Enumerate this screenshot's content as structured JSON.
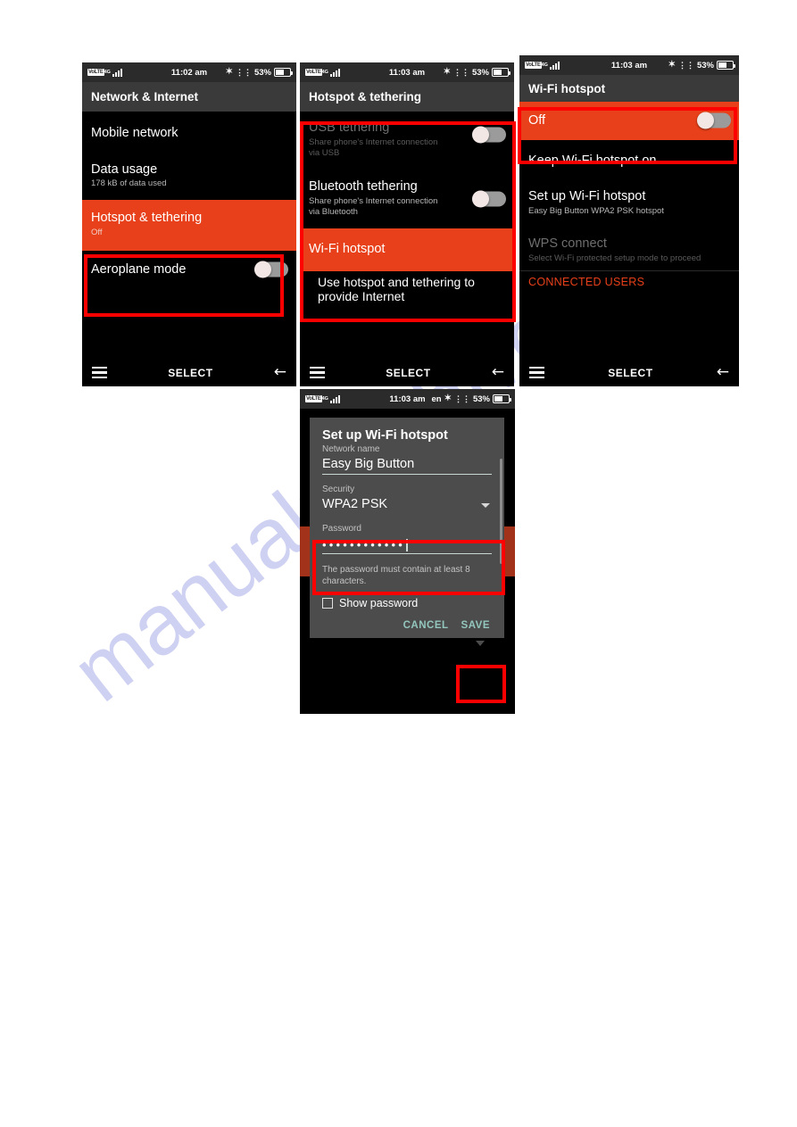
{
  "watermark": {
    "text": "manualsarchive.com"
  },
  "status_bar": {
    "network_badge": "VoLTE",
    "network_gen": "4G",
    "time_1": "11:02 am",
    "time_2": "11:03 am",
    "language": "en",
    "battery_percent": "53%",
    "bluetooth_icon": "bluetooth-icon",
    "vibrate_icon": "vibrate-icon",
    "battery_icon": "battery-icon",
    "signal_icon": "signal-bars-icon"
  },
  "nav_bar": {
    "menu_icon": "hamburger-menu-icon",
    "select_label": "SELECT",
    "back_icon": "back-arrow-icon"
  },
  "colors": {
    "highlight_orange": "#e8401a",
    "annotation_red": "#ff0000",
    "appbar_gray": "#3a3a3a",
    "dialog_gray": "#4c4c4c",
    "accent_teal": "#93c6bd"
  },
  "screen1": {
    "title": "Network & Internet",
    "time": "11:02 am",
    "rows": [
      {
        "title": "Mobile network",
        "sub": "",
        "state": "normal"
      },
      {
        "title": "Data usage",
        "sub": "178 kB of data used",
        "state": "normal"
      },
      {
        "title": "Hotspot & tethering",
        "sub": "Off",
        "state": "highlighted"
      },
      {
        "title": "Aeroplane mode",
        "sub": "",
        "state": "toggle-off"
      }
    ]
  },
  "screen2": {
    "title": "Hotspot & tethering",
    "time": "11:03 am",
    "rows": [
      {
        "title": "USB tethering",
        "sub": "Share phone's Internet connection via USB",
        "state": "disabled",
        "toggle": "off"
      },
      {
        "title": "Bluetooth tethering",
        "sub": "Share phone's Internet connection via Bluetooth",
        "state": "normal",
        "toggle": "off"
      },
      {
        "title": "Wi-Fi hotspot",
        "sub": "",
        "state": "highlighted"
      },
      {
        "title": "Use hotspot and tethering to provide Internet",
        "sub": "",
        "state": "normal"
      }
    ]
  },
  "screen3": {
    "title": "Wi-Fi hotspot",
    "time": "11:03 am",
    "rows": [
      {
        "title": "Off",
        "sub": "",
        "state": "highlighted",
        "toggle": "off"
      },
      {
        "title": "Keep Wi-Fi hotspot on",
        "sub": "",
        "state": "normal"
      },
      {
        "title": "Set up Wi-Fi hotspot",
        "sub": "Easy Big Button WPA2 PSK hotspot",
        "state": "normal"
      },
      {
        "title": "WPS connect",
        "sub": "Select Wi-Fi protected setup mode to proceed",
        "state": "disabled"
      }
    ],
    "section_header": "CONNECTED USERS"
  },
  "screen4": {
    "time": "11:03 am",
    "dialog": {
      "title": "Set up Wi-Fi hotspot",
      "network_name_label": "Network name",
      "network_name_value": "Easy Big Button",
      "security_label": "Security",
      "security_value": "WPA2 PSK",
      "password_label": "Password",
      "password_value": "••••••••••••",
      "hint": "The password must contain at least 8 characters.",
      "show_password_label": "Show password",
      "cancel_label": "CANCEL",
      "save_label": "SAVE"
    }
  }
}
